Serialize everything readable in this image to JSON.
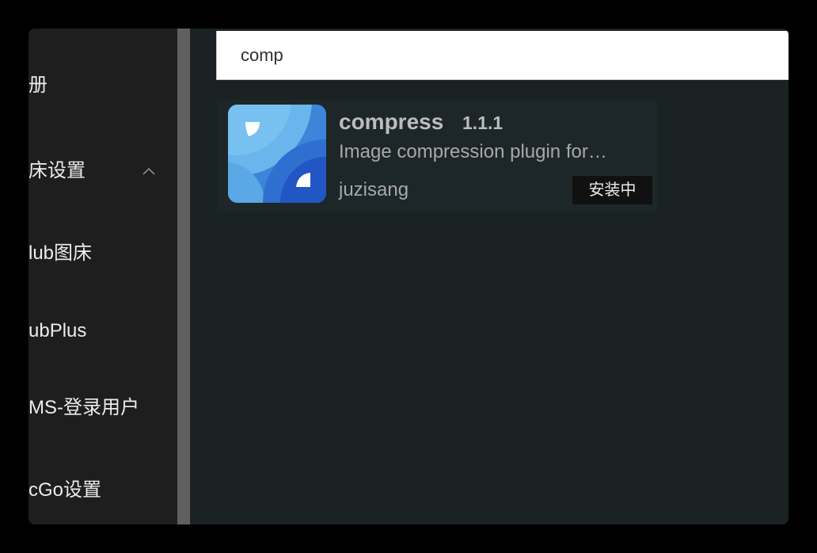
{
  "sidebar": {
    "items": [
      {
        "label": "册",
        "expandable": false
      },
      {
        "label": "床设置",
        "expandable": true,
        "chevron_icon": "chevron-up-icon"
      },
      {
        "label": "lub图床",
        "expandable": false
      },
      {
        "label": "ubPlus",
        "expandable": false
      },
      {
        "label": "MS-登录用户",
        "expandable": false
      },
      {
        "label": "cGo设置",
        "expandable": false
      }
    ]
  },
  "search": {
    "value": "comp",
    "placeholder": ""
  },
  "plugins": [
    {
      "name": "compress",
      "version": "1.1.1",
      "description": "Image compression plugin for…",
      "author": "juzisang",
      "status": "安装中",
      "logo_icon": "compress-logo-icon"
    }
  ],
  "colors": {
    "background": "#000000",
    "sidebar_bg": "#1e1e1e",
    "content_bg": "#1b2223",
    "card_bg": "#1d2628",
    "scrollbar": "#5f5f5f",
    "logo_light_blue": "#5fb0ea",
    "logo_mid_blue": "#3d85d8",
    "logo_dark_blue": "#2256c5"
  }
}
